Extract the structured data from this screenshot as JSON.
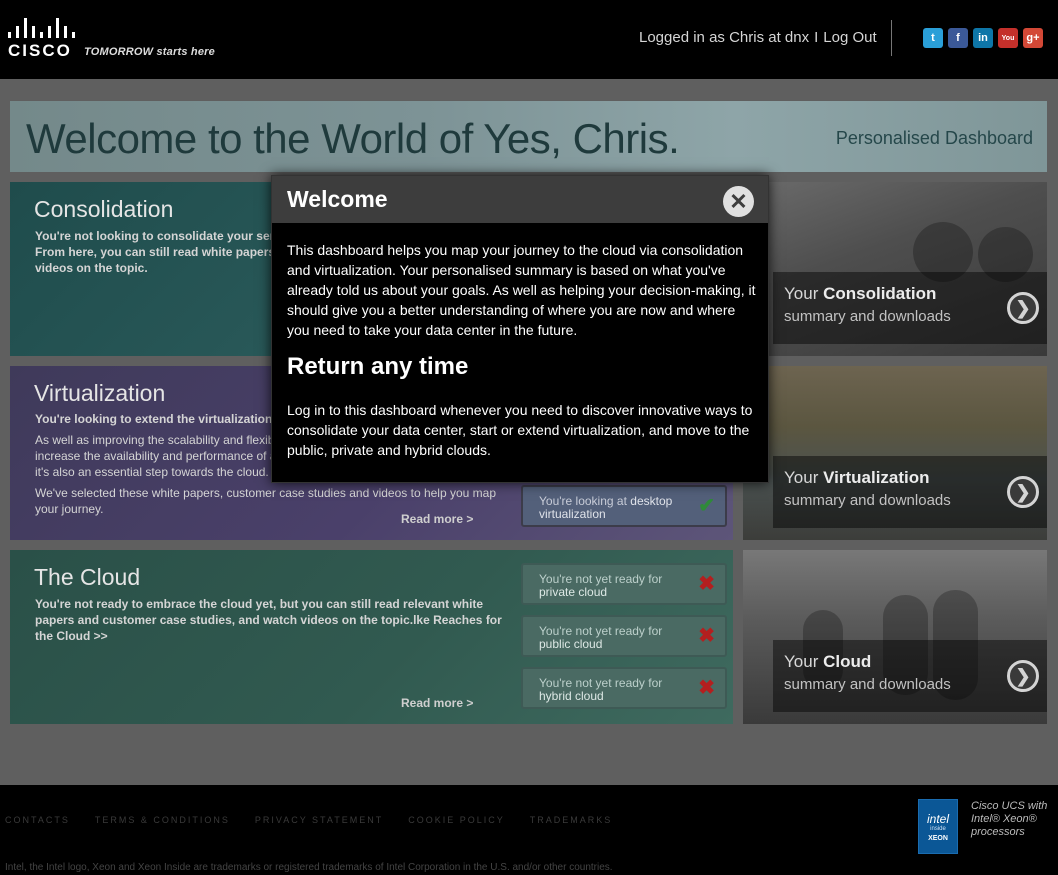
{
  "header": {
    "logo_text": "CISCO",
    "tagline": "TOMORROW starts here",
    "login_text": "Logged in as Chris at dnx",
    "separator": "I",
    "logout_label": "Log Out",
    "social": [
      {
        "name": "twitter-icon",
        "glyph": "t",
        "color": "#2a9fd8"
      },
      {
        "name": "facebook-icon",
        "glyph": "f",
        "color": "#3b5998"
      },
      {
        "name": "linkedin-icon",
        "glyph": "in",
        "color": "#0e76a8"
      },
      {
        "name": "youtube-icon",
        "glyph": "You",
        "color": "#c4302b"
      },
      {
        "name": "googleplus-icon",
        "glyph": "g+",
        "color": "#d34836"
      }
    ]
  },
  "banner": {
    "title": "Welcome to the World of Yes, Chris.",
    "subtitle": "Personalised Dashboard"
  },
  "panels": {
    "consolidation": {
      "title": "Consolidation",
      "text": "You're not looking to consolidate your servers, storage or network infrastructure. From here, you can still read white papers, customer case studies, and watch videos on the topic."
    },
    "virtualization": {
      "title": "Virtualization",
      "text1": "You're looking to extend the virtualization of your data center.",
      "text2": "As well as improving the scalability and flexibility of your data center, virtualization can increase the availability and performance of applications and cut your operating costs, it's also an essential step towards the cloud.",
      "text3": "We've selected these white papers, customer case studies and videos to help you map your journey.",
      "readmore": "Read more >",
      "status": {
        "prefix": "You're looking at",
        "bold": "desktop",
        "bold2": "virtualization",
        "mark": "✔"
      }
    },
    "cloud": {
      "title": "The Cloud",
      "text": "You're not ready to embrace the cloud yet, but you can still read relevant white papers and customer case studies, and watch videos on the topic.lke Reaches for the Cloud >>",
      "readmore": "Read more >",
      "statuses": [
        {
          "prefix": "You're not yet ready for",
          "bold": "private cloud",
          "mark": "✖"
        },
        {
          "prefix": "You're not yet ready for",
          "bold": "public cloud",
          "mark": "✖"
        },
        {
          "prefix": "You're not yet ready for",
          "bold": "hybrid cloud",
          "mark": "✖"
        }
      ]
    }
  },
  "side_cards": [
    {
      "your": "Your",
      "title": "Consolidation",
      "sub": "summary and downloads"
    },
    {
      "your": "Your",
      "title": "Virtualization",
      "sub": "summary and downloads"
    },
    {
      "your": "Your",
      "title": "Cloud",
      "sub": "summary and downloads"
    }
  ],
  "modal": {
    "title": "Welcome",
    "close_glyph": "✕",
    "body": "This dashboard helps you map your journey to the cloud via consolidation and virtualization. Your personalised summary is based on what you've already told us about your goals. As well as helping your decision-making, it should give you a better understanding of where you are now and where you need to take your data center in the future.",
    "heading2": "Return any time",
    "body2": "Log in to this dashboard whenever you need to discover innovative ways to consolidate your data center, start or extend virtualization, and move to the public, private and hybrid clouds."
  },
  "footer": {
    "links": [
      "CONTACTS",
      "TERMS & CONDITIONS",
      "PRIVACY STATEMENT",
      "COOKIE POLICY",
      "TRADEMARKS"
    ],
    "note": "Intel, the Intel logo, Xeon and Xeon Inside are trademarks or registered trademarks of Intel Corporation in the U.S. and/or other countries.",
    "intel_badge": {
      "brand": "intel",
      "inside": "inside",
      "product": "XEON"
    },
    "intel_text": "Cisco UCS with Intel® Xeon® processors"
  },
  "colors": {
    "ok_mark": "#2f8a3a",
    "fail_mark": "#b41f1f"
  }
}
